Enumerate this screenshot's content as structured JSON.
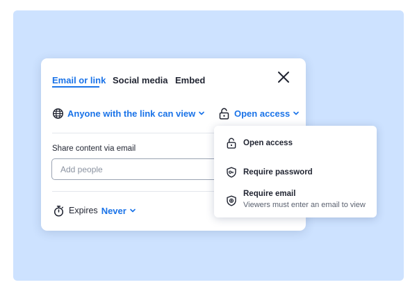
{
  "share_dialog": {
    "tabs": [
      {
        "label": "Email or link",
        "active": true
      },
      {
        "label": "Social media",
        "active": false
      },
      {
        "label": "Embed",
        "active": false
      }
    ],
    "link_permission": "Anyone with the link can view",
    "access_level": "Open access",
    "email_section_label": "Share content via email",
    "email_input_placeholder": "Add people",
    "expires_label": "Expires",
    "expires_value": "Never",
    "access_menu": [
      {
        "title": "Open access",
        "subtitle": "",
        "icon": "unlock-icon"
      },
      {
        "title": "Require password",
        "subtitle": "",
        "icon": "shield-key-icon"
      },
      {
        "title": "Require email",
        "subtitle": "Viewers must enter an email to view",
        "icon": "shield-email-icon"
      }
    ]
  },
  "colors": {
    "accent": "#1a73e8",
    "backdrop": "#cde2ff",
    "text": "#1f2330"
  }
}
